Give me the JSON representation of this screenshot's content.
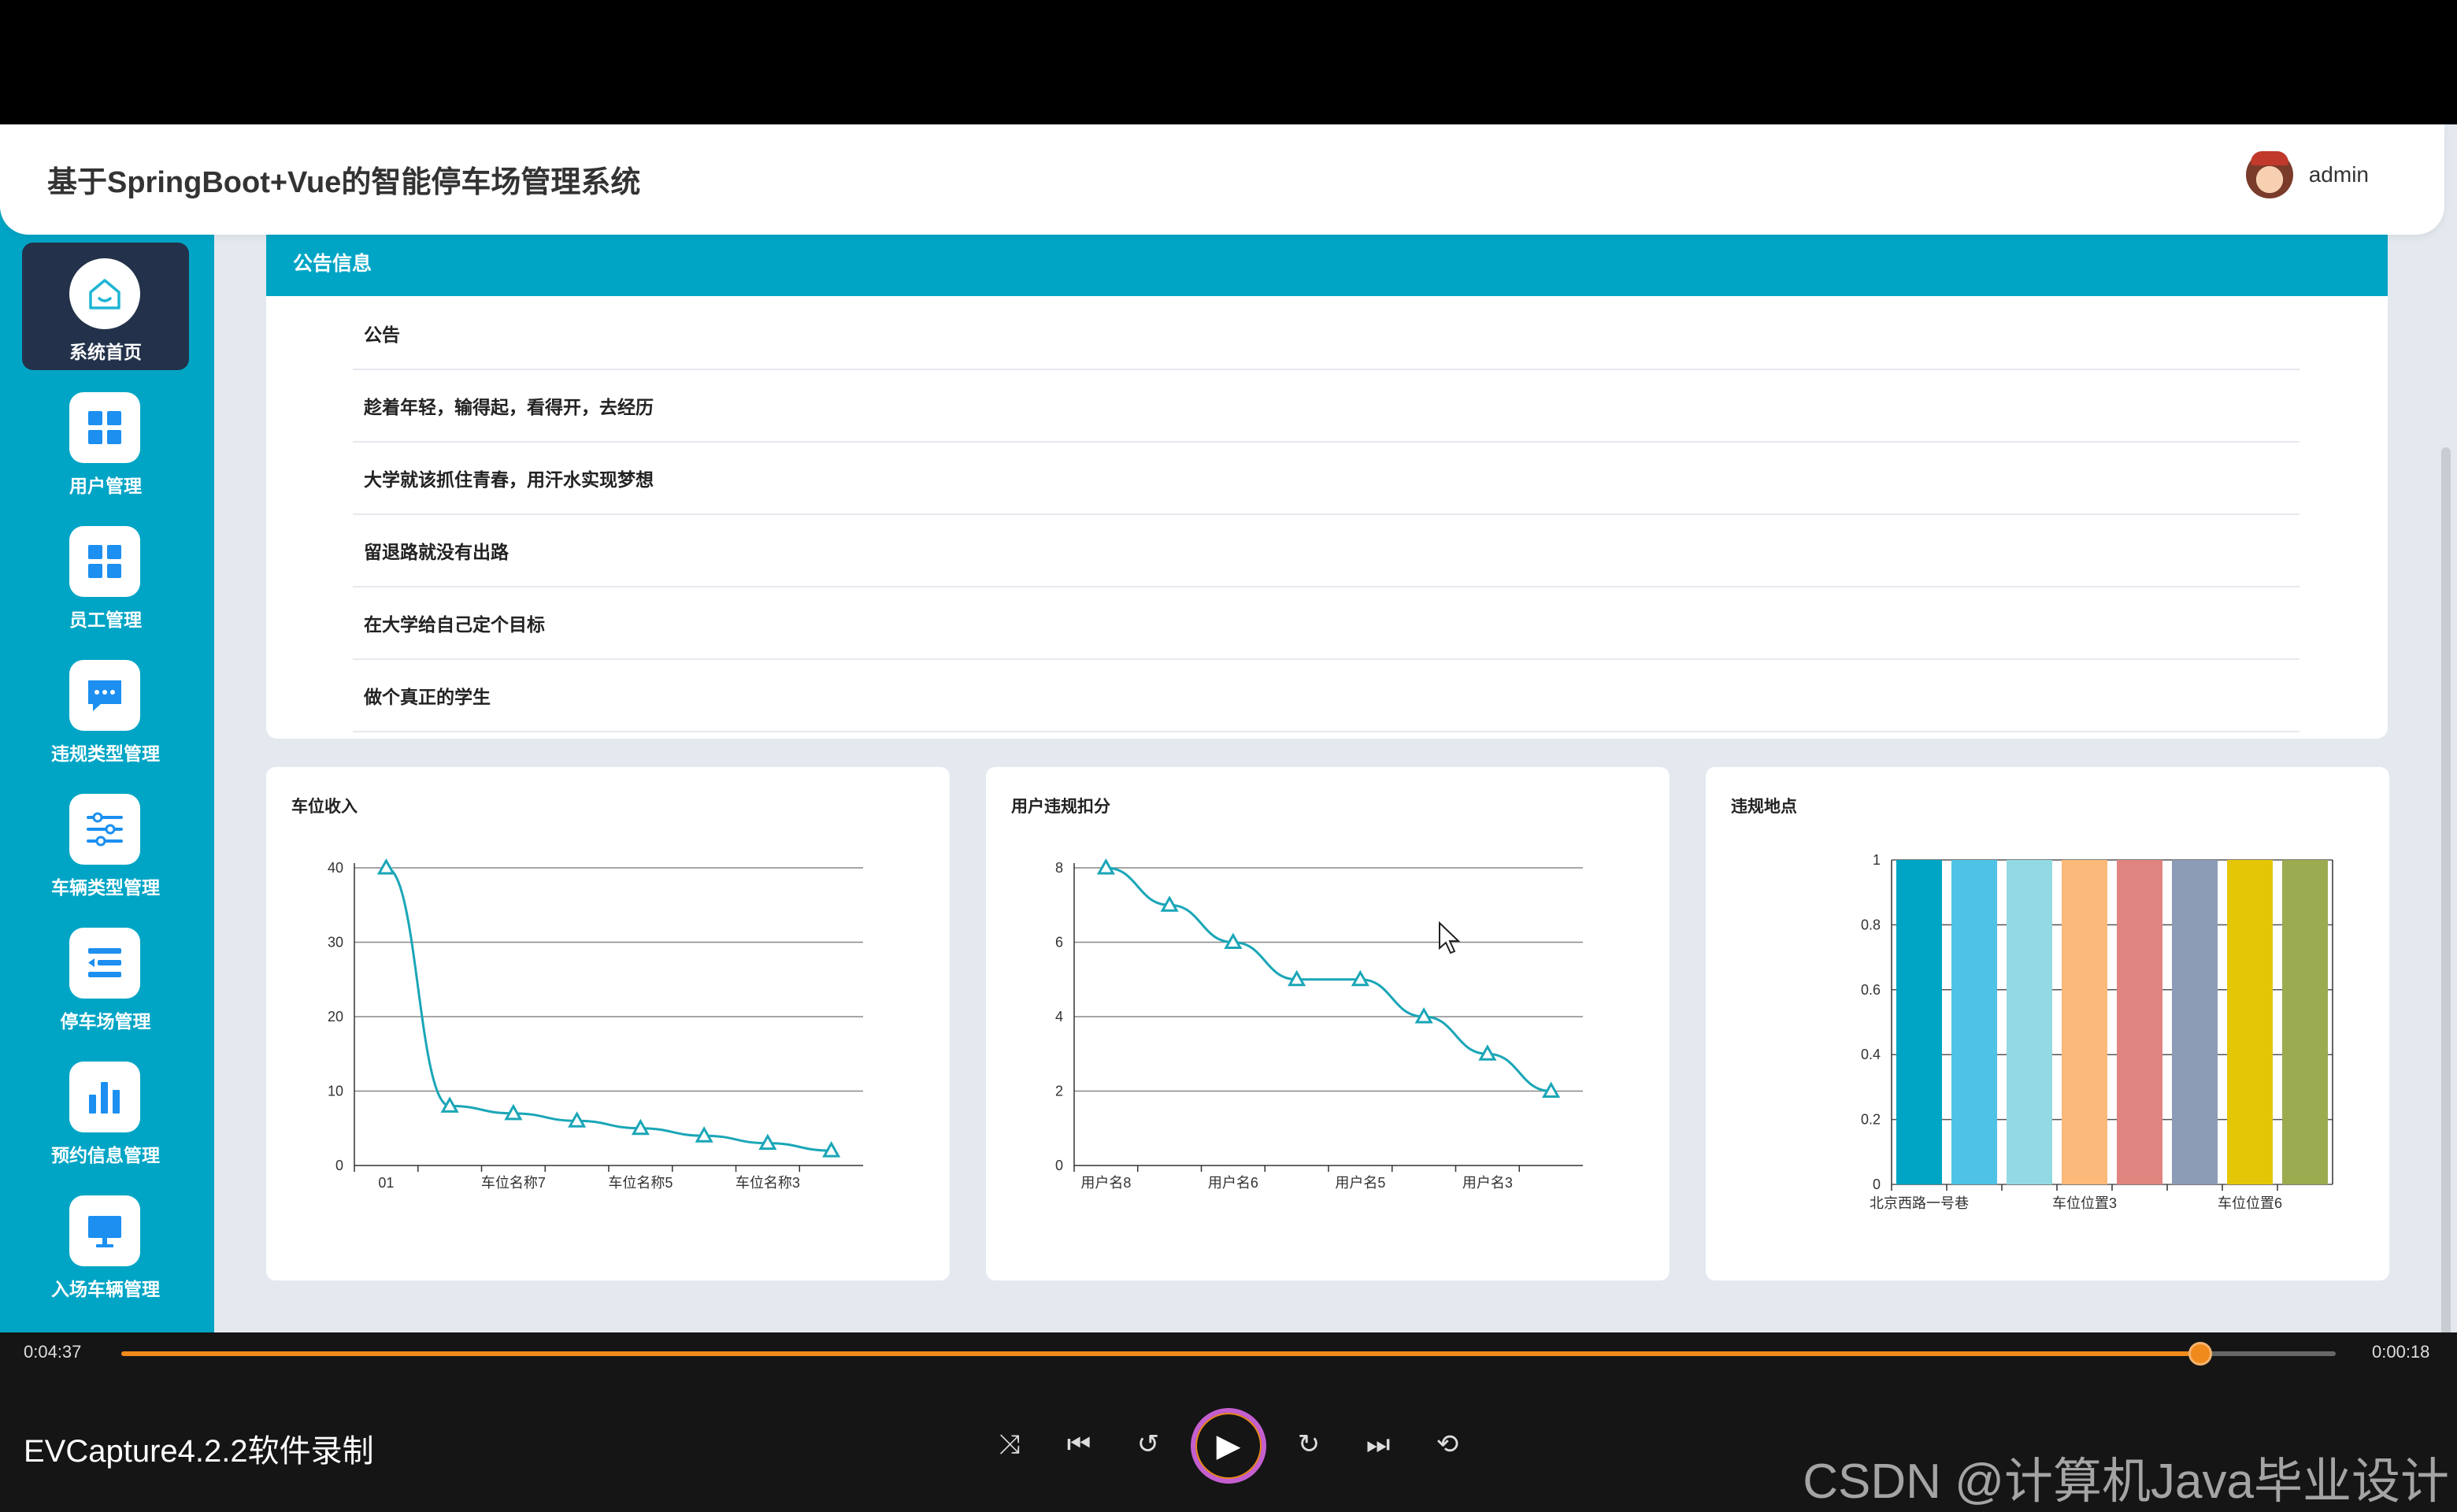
{
  "header": {
    "title": "基于SpringBoot+Vue的智能停车场管理系统",
    "username": "admin"
  },
  "sidebar": {
    "items": [
      {
        "label": "系统首页",
        "icon": "home-icon",
        "active": true
      },
      {
        "label": "用户管理",
        "icon": "grid-icon"
      },
      {
        "label": "员工管理",
        "icon": "grid-icon"
      },
      {
        "label": "违规类型管理",
        "icon": "chat-icon"
      },
      {
        "label": "车辆类型管理",
        "icon": "sliders-icon"
      },
      {
        "label": "停车场管理",
        "icon": "list-icon"
      },
      {
        "label": "预约信息管理",
        "icon": "bar-chart-icon"
      },
      {
        "label": "入场车辆管理",
        "icon": "monitor-icon"
      }
    ]
  },
  "notice": {
    "title": "公告信息",
    "items": [
      "公告",
      "趁着年轻，输得起，看得开，去经历",
      "大学就该抓住青春，用汗水实现梦想",
      "留退路就没有出路",
      "在大学给自己定个目标",
      "做个真正的学生"
    ]
  },
  "chart_data": [
    {
      "type": "line",
      "title": "车位收入",
      "categories": [
        "01",
        "",
        "车位名称7",
        "",
        "车位名称5",
        "",
        "车位名称3",
        ""
      ],
      "values": [
        40,
        8,
        7,
        6,
        5,
        4,
        3,
        2
      ],
      "ylim": [
        0,
        40
      ],
      "yticks": [
        0,
        10,
        20,
        30,
        40
      ],
      "tick_labels": [
        "01",
        "车位名称7",
        "车位名称5",
        "车位名称3"
      ],
      "color": "#1aa6b7",
      "grid": true
    },
    {
      "type": "line",
      "title": "用户违规扣分",
      "categories": [
        "用户名8",
        "",
        "用户名6",
        "",
        "用户名5",
        "",
        "用户名3",
        ""
      ],
      "values": [
        8,
        7,
        6,
        5,
        5,
        4,
        3,
        2
      ],
      "ylim": [
        0,
        8
      ],
      "yticks": [
        0,
        2,
        4,
        6,
        8
      ],
      "tick_labels": [
        "用户名8",
        "用户名6",
        "用户名5",
        "用户名3"
      ],
      "color": "#1aa6b7",
      "grid": true
    },
    {
      "type": "bar",
      "title": "违规地点",
      "categories": [
        "北京西路一号巷",
        "",
        "",
        "车位位置3",
        "",
        "",
        "车位位置6",
        ""
      ],
      "values": [
        1,
        1,
        1,
        1,
        1,
        1,
        1,
        1
      ],
      "ylim": [
        0,
        1
      ],
      "yticks": [
        0,
        0.2,
        0.4,
        0.6,
        0.8,
        1
      ],
      "tick_labels": [
        "北京西路一号巷",
        "车位位置3",
        "车位位置6"
      ],
      "colors": [
        "#00a5c5",
        "#4fc3e6",
        "#92d9e3",
        "#fbb97a",
        "#e0847f",
        "#8c9cb6",
        "#e4c607",
        "#9bab4f"
      ],
      "grid": true
    }
  ],
  "player": {
    "elapsed": "0:04:37",
    "remaining": "0:00:18",
    "progress": 0.939,
    "recorder_label": "EVCapture4.2.2软件录制",
    "watermark": "CSDN @计算机Java毕业设计",
    "controls": [
      "shuffle-icon",
      "previous-icon",
      "rewind-10-icon",
      "play-icon",
      "forward-30-icon",
      "next-icon",
      "repeat-icon"
    ]
  }
}
